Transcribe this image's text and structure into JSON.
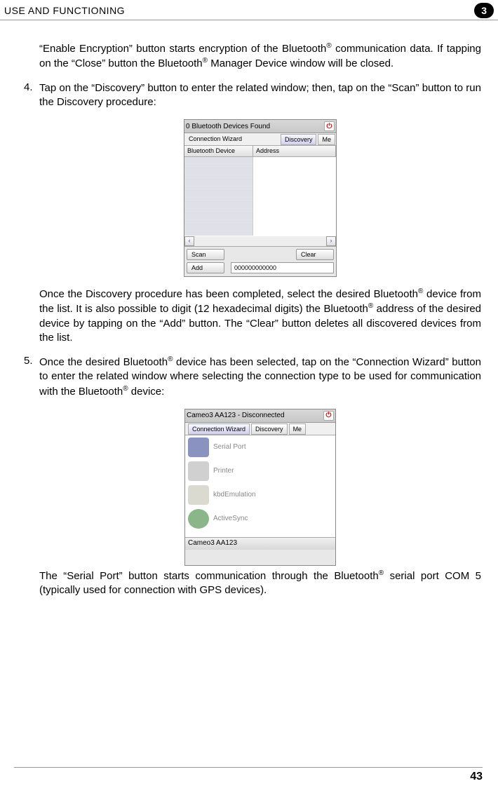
{
  "header": {
    "title": "USE AND FUNCTIONING",
    "chapter": "3"
  },
  "para1_a": "“Enable Encryption” button starts encryption of the Bluetooth",
  "para1_b": " communication data. If tapping on the “Close” button the Bluetooth",
  "para1_c": " Manager Device window will be closed.",
  "item4_num": "4.",
  "item4_text": "Tap on the “Discovery” button to enter the related window; then, tap on the “Scan” button to run the Discovery procedure:",
  "ss1": {
    "title": "0 Bluetooth Devices Found",
    "tab1": "Connection Wizard",
    "tab2": "Discovery",
    "tab3": "Me",
    "col1": "Bluetooth Device",
    "col2": "Address",
    "scan": "Scan",
    "clear": "Clear",
    "add": "Add",
    "addr": "000000000000"
  },
  "para2_a": "Once the Discovery procedure has been completed, select the desired Bluetooth",
  "para2_b": " device from the list. It is also possible to digit (12 hexadecimal digits) the Bluetooth",
  "para2_c": " address of the desired device by tapping on the “Add” button. The “Clear” button deletes all discovered devices from the list.",
  "item5_num": "5.",
  "item5_a": "Once the desired Bluetooth",
  "item5_b": " device has been selected, tap on the “Connection Wizard” button to enter the related window where selecting the connection type to be used for communication with the Bluetooth",
  "item5_c": " device:",
  "ss2": {
    "title": "Cameo3 AA123 - Disconnected",
    "tab1": "Connection Wizard",
    "tab2": "Discovery",
    "tab3": "Me",
    "i1": "Serial Port",
    "i2": "Printer",
    "i3": "kbdEmulation",
    "i4": "ActiveSync",
    "status": "Cameo3 AA123"
  },
  "para3_a": "The “Serial Port” button starts communication through the Bluetooth",
  "para3_b": " serial port COM 5 (typically used for connection with GPS devices).",
  "reg": "®",
  "page_number": "43"
}
